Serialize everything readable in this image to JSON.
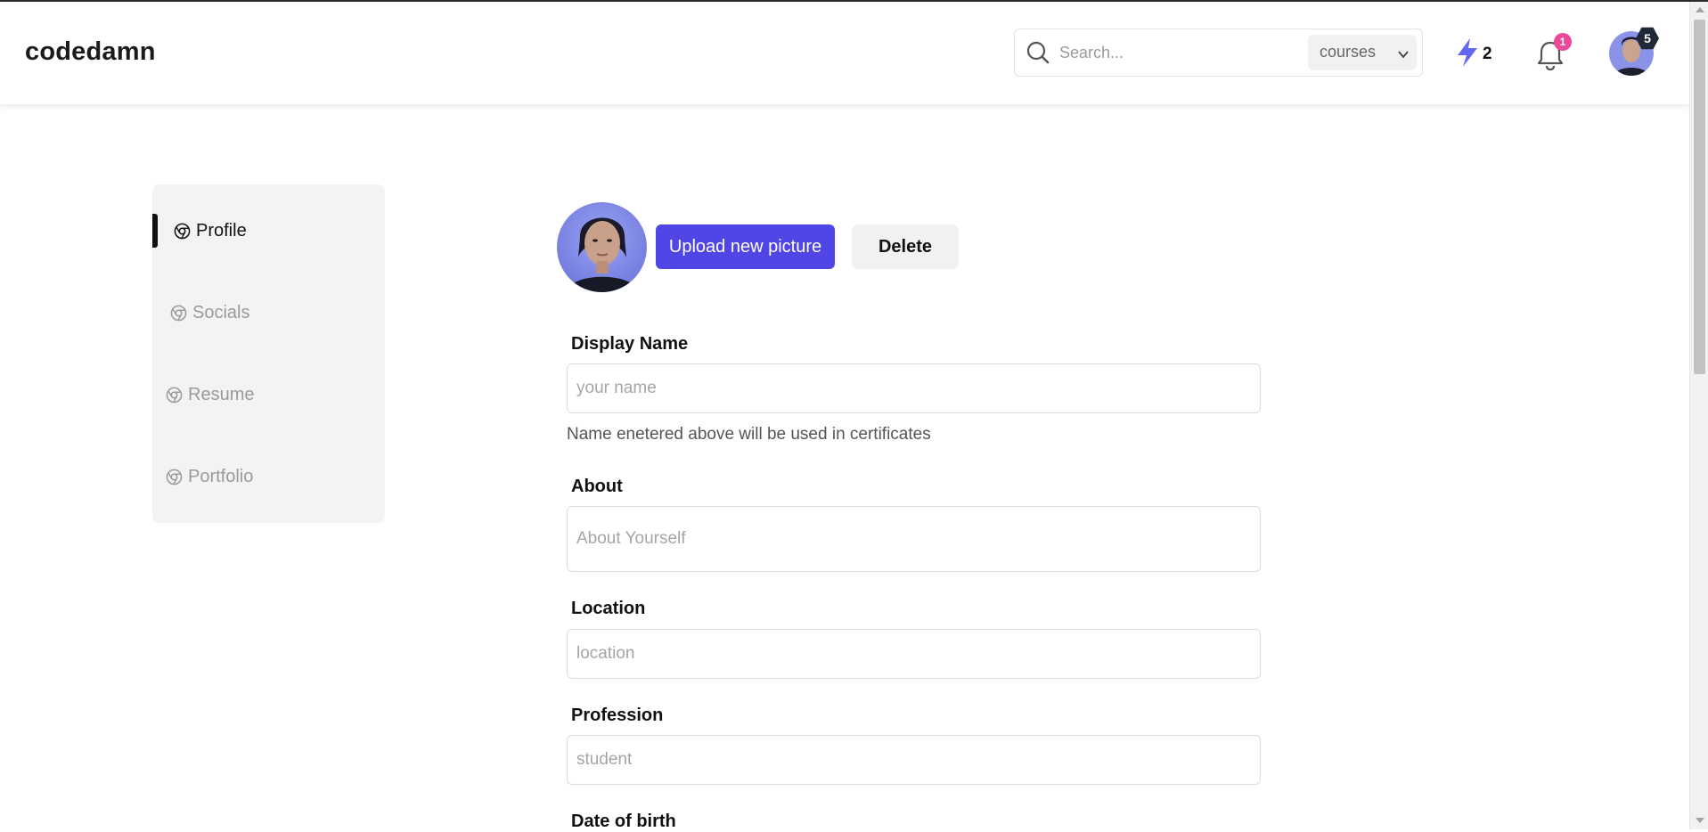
{
  "header": {
    "logo": "codedamn",
    "search": {
      "placeholder": "Search...",
      "filter": "courses"
    },
    "streak_count": "2",
    "notification_count": "1",
    "avatar_badge": "5"
  },
  "sidebar": {
    "items": [
      {
        "label": "Profile",
        "active": true
      },
      {
        "label": "Socials",
        "active": false
      },
      {
        "label": "Resume",
        "active": false
      },
      {
        "label": "Portfolio",
        "active": false
      }
    ]
  },
  "profile_picture": {
    "upload_label": "Upload new picture",
    "delete_label": "Delete"
  },
  "form": {
    "display_name": {
      "label": "Display Name",
      "placeholder": "your name",
      "hint": "Name enetered above will be used in certificates"
    },
    "about": {
      "label": "About",
      "placeholder": "About Yourself"
    },
    "location": {
      "label": "Location",
      "placeholder": "location"
    },
    "profession": {
      "label": "Profession",
      "placeholder": "student"
    },
    "dob": {
      "label": "Date of birth"
    }
  },
  "colors": {
    "accent": "#4f46e5",
    "notification_badge": "#ec4899",
    "bolt": "#6366f1"
  }
}
